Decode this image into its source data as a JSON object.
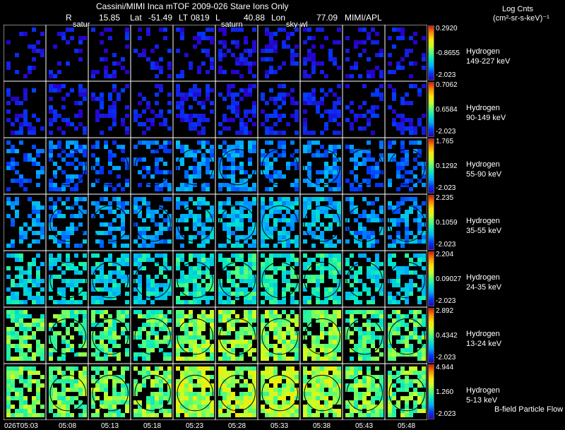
{
  "header": {
    "title": "Cassini/MIMI Inca mTOF  2009-026   Stare   Ions Only",
    "r_label": "R",
    "r_value": "15.85",
    "lat_label": "Lat",
    "lat_value": "-51.49",
    "lt_label": "LT",
    "lt_value": "0819",
    "l_label": "L",
    "l_value": "40.88",
    "lon_label": "Lon",
    "lon_value": "77.09",
    "org": "MIMI/APL",
    "labels": [
      "satur",
      "saturn",
      "sky-wl"
    ]
  },
  "units": {
    "line1": "Log Cnts",
    "line2": "(cm²-sr-s-keV)⁻¹"
  },
  "rows": [
    {
      "species": "Hydrogen",
      "energy": "149-227 keV",
      "max": "0.2920",
      "mid": "-0.8655",
      "min": "-2.023",
      "base": 0.08
    },
    {
      "species": "Hydrogen",
      "energy": "90-149 keV",
      "max": "0.7062",
      "mid": "0.6584",
      "min": "-2.023",
      "base": 0.1
    },
    {
      "species": "Hydrogen",
      "energy": "55-90 keV",
      "max": "1.765",
      "mid": "0.1292",
      "min": "-2.023",
      "base": 0.25
    },
    {
      "species": "Hydrogen",
      "energy": "35-55 keV",
      "max": "2.235",
      "mid": "0.1059",
      "min": "-2.023",
      "base": 0.33
    },
    {
      "species": "Hydrogen",
      "energy": "24-35 keV",
      "max": "2.204",
      "mid": "0.09027",
      "min": "-2.023",
      "base": 0.45
    },
    {
      "species": "Hydrogen",
      "energy": "13-24 keV",
      "max": "2.892",
      "mid": "0.4342",
      "min": "-2.023",
      "base": 0.58
    },
    {
      "species": "Hydrogen",
      "energy": "5-13 keV",
      "max": "4.944",
      "mid": "1.260",
      "min": "-2.023",
      "base": 0.62
    }
  ],
  "times": [
    "026T05:03",
    "05:08",
    "05:13",
    "05:18",
    "05:23",
    "05:28",
    "05:33",
    "05:38",
    "05:43",
    "05:48"
  ],
  "footer_note": "B-field Particle Flow",
  "colors": {
    "background": "#000000",
    "grid_line": "#ffffff",
    "text": "#ffffff"
  }
}
